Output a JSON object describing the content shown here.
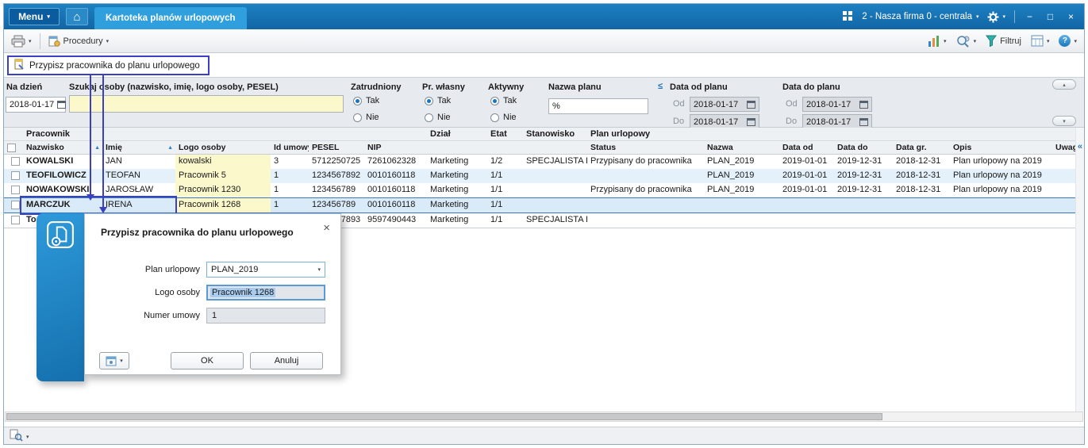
{
  "titlebar": {
    "menu_label": "Menu",
    "tab_label": "Kartoteka planów urlopowych",
    "company_label": "2 - Nasza firma 0 - centrala"
  },
  "toolbar": {
    "procedury_label": "Procedury",
    "filtruj_label": "Filtruj"
  },
  "callout": {
    "text": "Przypisz pracownika do planu urlopowego"
  },
  "filters": {
    "na_dzien": {
      "label": "Na dzień",
      "value": "2018-01-17"
    },
    "szukaj": {
      "label": "Szukaj osoby (nazwisko, imię, logo osoby, PESEL)",
      "value": ""
    },
    "zatrudniony": {
      "label": "Zatrudniony",
      "option_tak": "Tak",
      "option_nie": "Nie",
      "selected": "Tak"
    },
    "pr_wlasny": {
      "label": "Pr. własny",
      "option_tak": "Tak",
      "option_nie": "Nie",
      "selected": "Tak"
    },
    "aktywny": {
      "label": "Aktywny",
      "option_tak": "Tak",
      "option_nie": "Nie",
      "selected": "Tak"
    },
    "nazwa_planu": {
      "label": "Nazwa planu",
      "value": "%"
    },
    "operator": "≤",
    "data_od_planu": {
      "label": "Data od planu",
      "od_label": "Od",
      "od_value": "2018-01-17",
      "do_label": "Do",
      "do_value": "2018-01-17"
    },
    "data_do_planu": {
      "label": "Data do planu",
      "od_label": "Od",
      "od_value": "2018-01-17",
      "do_label": "Do",
      "do_value": "2018-01-17"
    }
  },
  "table": {
    "groups": {
      "pracownik": "Pracownik",
      "dzial": "Dział",
      "etat": "Etat",
      "stanowisko": "Stanowisko",
      "plan_urlopowy": "Plan urlopowy"
    },
    "headers": {
      "nazwisko": "Nazwisko",
      "imie": "Imię",
      "logo": "Logo osoby",
      "id_umowy": "Id umowy",
      "pesel": "PESEL",
      "nip": "NIP",
      "status": "Status",
      "nazwa": "Nazwa",
      "data_od": "Data od",
      "data_do": "Data do",
      "data_gr": "Data gr.",
      "opis": "Opis",
      "uwagi": "Uwagi"
    },
    "rows": [
      {
        "nazwisko": "KOWALSKI",
        "imie": "JAN",
        "logo": "kowalski",
        "id_umowy": "3",
        "pesel": "5712250725",
        "nip": "7261062328",
        "dzial": "Marketing",
        "etat": "1/2",
        "stanowisko": "SPECJALISTA D",
        "status": "Przypisany do pracownika",
        "nazwa": "PLAN_2019",
        "data_od": "2019-01-01",
        "data_do": "2019-12-31",
        "data_gr": "2018-12-31",
        "opis": "Plan urlopowy na 2019",
        "uwagi": ""
      },
      {
        "nazwisko": "TEOFILOWICZ",
        "imie": "TEOFAN",
        "logo": "Pracownik 5",
        "id_umowy": "1",
        "pesel": "1234567892",
        "nip": "0010160118",
        "dzial": "Marketing",
        "etat": "1/1",
        "stanowisko": "",
        "status": "",
        "nazwa": "PLAN_2019",
        "data_od": "2019-01-01",
        "data_do": "2019-12-31",
        "data_gr": "2018-12-31",
        "opis": "Plan urlopowy na 2019",
        "uwagi": ""
      },
      {
        "nazwisko": "NOWAKOWSKI",
        "imie": "JAROSŁAW",
        "logo": "Pracownik 1230",
        "id_umowy": "1",
        "pesel": "123456789",
        "nip": "0010160118",
        "dzial": "Marketing",
        "etat": "1/1",
        "stanowisko": "",
        "status": "Przypisany do pracownika",
        "nazwa": "PLAN_2019",
        "data_od": "2019-01-01",
        "data_do": "2019-12-31",
        "data_gr": "2018-12-31",
        "opis": "Plan urlopowy na 2019",
        "uwagi": ""
      },
      {
        "nazwisko": "MARCZUK",
        "imie": "IRENA",
        "logo": "Pracownik 1268",
        "id_umowy": "1",
        "pesel": "123456789",
        "nip": "0010160118",
        "dzial": "Marketing",
        "etat": "1/1",
        "stanowisko": "",
        "status": "",
        "nazwa": "",
        "data_od": "",
        "data_do": "",
        "data_gr": "",
        "opis": "",
        "uwagi": ""
      },
      {
        "nazwisko": "To",
        "imie": "",
        "logo": "",
        "id_umowy": "",
        "pesel": "1234567893",
        "nip": "9597490443",
        "dzial": "Marketing",
        "etat": "1/1",
        "stanowisko": "SPECJALISTA D",
        "status": "",
        "nazwa": "",
        "data_od": "",
        "data_do": "",
        "data_gr": "",
        "opis": "",
        "uwagi": ""
      }
    ],
    "selected_row_index": 3
  },
  "dialog": {
    "title": "Przypisz pracownika do planu urlopowego",
    "plan_urlopowy": {
      "label": "Plan urlopowy",
      "value": "PLAN_2019"
    },
    "logo_osoby": {
      "label": "Logo osoby",
      "value": "Pracownik 1268"
    },
    "numer_umowy": {
      "label": "Numer umowy",
      "value": "1"
    },
    "ok_label": "OK",
    "anuluj_label": "Anuluj"
  },
  "colors": {
    "titlebar_blue": "#1371b4",
    "active_tab_blue": "#2f9fdd",
    "dialog_accent_blue": "#1b85ca",
    "annotation_blue": "#3b3fc4",
    "input_yellow": "#fbf8cc",
    "selected_row_blue": "#d9eaf8"
  }
}
